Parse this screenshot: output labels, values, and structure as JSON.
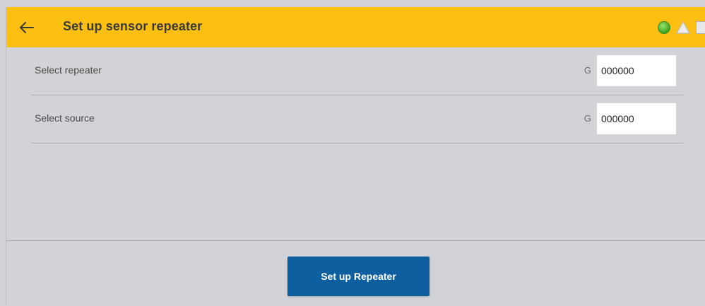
{
  "header": {
    "title": "Set up sensor repeater",
    "back_icon": "arrow-left-icon",
    "status_icons": [
      "status-ok-icon",
      "warning-triangle-icon",
      "square-icon"
    ],
    "background": "#fdbf12"
  },
  "form": {
    "rows": [
      {
        "label": "Select repeater",
        "prefix": "G",
        "value": "000000"
      },
      {
        "label": "Select source",
        "prefix": "G",
        "value": "000000"
      }
    ]
  },
  "footer": {
    "primary_button": "Set up Repeater",
    "primary_color": "#0e5fa0"
  }
}
